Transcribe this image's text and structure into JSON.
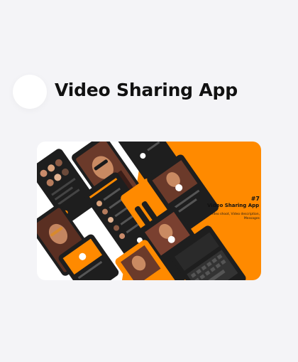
{
  "page": {
    "title": "Video Sharing App"
  },
  "card": {
    "kit_number": "#7",
    "kit_name": "Video Sharing App UI Kit",
    "kit_description": "Video shoot, Video description, Messages"
  },
  "colors": {
    "accent": "#ff8a00",
    "phone_dark": "#1e1e1e",
    "background": "#f4f4f7"
  }
}
